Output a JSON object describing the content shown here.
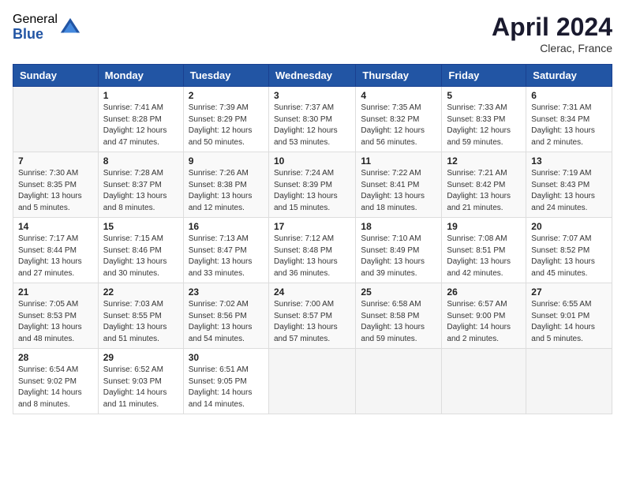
{
  "header": {
    "logo_general": "General",
    "logo_blue": "Blue",
    "title": "April 2024",
    "location": "Clerac, France"
  },
  "days_of_week": [
    "Sunday",
    "Monday",
    "Tuesday",
    "Wednesday",
    "Thursday",
    "Friday",
    "Saturday"
  ],
  "weeks": [
    [
      {
        "day": "",
        "info": ""
      },
      {
        "day": "1",
        "info": "Sunrise: 7:41 AM\nSunset: 8:28 PM\nDaylight: 12 hours\nand 47 minutes."
      },
      {
        "day": "2",
        "info": "Sunrise: 7:39 AM\nSunset: 8:29 PM\nDaylight: 12 hours\nand 50 minutes."
      },
      {
        "day": "3",
        "info": "Sunrise: 7:37 AM\nSunset: 8:30 PM\nDaylight: 12 hours\nand 53 minutes."
      },
      {
        "day": "4",
        "info": "Sunrise: 7:35 AM\nSunset: 8:32 PM\nDaylight: 12 hours\nand 56 minutes."
      },
      {
        "day": "5",
        "info": "Sunrise: 7:33 AM\nSunset: 8:33 PM\nDaylight: 12 hours\nand 59 minutes."
      },
      {
        "day": "6",
        "info": "Sunrise: 7:31 AM\nSunset: 8:34 PM\nDaylight: 13 hours\nand 2 minutes."
      }
    ],
    [
      {
        "day": "7",
        "info": "Sunrise: 7:30 AM\nSunset: 8:35 PM\nDaylight: 13 hours\nand 5 minutes."
      },
      {
        "day": "8",
        "info": "Sunrise: 7:28 AM\nSunset: 8:37 PM\nDaylight: 13 hours\nand 8 minutes."
      },
      {
        "day": "9",
        "info": "Sunrise: 7:26 AM\nSunset: 8:38 PM\nDaylight: 13 hours\nand 12 minutes."
      },
      {
        "day": "10",
        "info": "Sunrise: 7:24 AM\nSunset: 8:39 PM\nDaylight: 13 hours\nand 15 minutes."
      },
      {
        "day": "11",
        "info": "Sunrise: 7:22 AM\nSunset: 8:41 PM\nDaylight: 13 hours\nand 18 minutes."
      },
      {
        "day": "12",
        "info": "Sunrise: 7:21 AM\nSunset: 8:42 PM\nDaylight: 13 hours\nand 21 minutes."
      },
      {
        "day": "13",
        "info": "Sunrise: 7:19 AM\nSunset: 8:43 PM\nDaylight: 13 hours\nand 24 minutes."
      }
    ],
    [
      {
        "day": "14",
        "info": "Sunrise: 7:17 AM\nSunset: 8:44 PM\nDaylight: 13 hours\nand 27 minutes."
      },
      {
        "day": "15",
        "info": "Sunrise: 7:15 AM\nSunset: 8:46 PM\nDaylight: 13 hours\nand 30 minutes."
      },
      {
        "day": "16",
        "info": "Sunrise: 7:13 AM\nSunset: 8:47 PM\nDaylight: 13 hours\nand 33 minutes."
      },
      {
        "day": "17",
        "info": "Sunrise: 7:12 AM\nSunset: 8:48 PM\nDaylight: 13 hours\nand 36 minutes."
      },
      {
        "day": "18",
        "info": "Sunrise: 7:10 AM\nSunset: 8:49 PM\nDaylight: 13 hours\nand 39 minutes."
      },
      {
        "day": "19",
        "info": "Sunrise: 7:08 AM\nSunset: 8:51 PM\nDaylight: 13 hours\nand 42 minutes."
      },
      {
        "day": "20",
        "info": "Sunrise: 7:07 AM\nSunset: 8:52 PM\nDaylight: 13 hours\nand 45 minutes."
      }
    ],
    [
      {
        "day": "21",
        "info": "Sunrise: 7:05 AM\nSunset: 8:53 PM\nDaylight: 13 hours\nand 48 minutes."
      },
      {
        "day": "22",
        "info": "Sunrise: 7:03 AM\nSunset: 8:55 PM\nDaylight: 13 hours\nand 51 minutes."
      },
      {
        "day": "23",
        "info": "Sunrise: 7:02 AM\nSunset: 8:56 PM\nDaylight: 13 hours\nand 54 minutes."
      },
      {
        "day": "24",
        "info": "Sunrise: 7:00 AM\nSunset: 8:57 PM\nDaylight: 13 hours\nand 57 minutes."
      },
      {
        "day": "25",
        "info": "Sunrise: 6:58 AM\nSunset: 8:58 PM\nDaylight: 13 hours\nand 59 minutes."
      },
      {
        "day": "26",
        "info": "Sunrise: 6:57 AM\nSunset: 9:00 PM\nDaylight: 14 hours\nand 2 minutes."
      },
      {
        "day": "27",
        "info": "Sunrise: 6:55 AM\nSunset: 9:01 PM\nDaylight: 14 hours\nand 5 minutes."
      }
    ],
    [
      {
        "day": "28",
        "info": "Sunrise: 6:54 AM\nSunset: 9:02 PM\nDaylight: 14 hours\nand 8 minutes."
      },
      {
        "day": "29",
        "info": "Sunrise: 6:52 AM\nSunset: 9:03 PM\nDaylight: 14 hours\nand 11 minutes."
      },
      {
        "day": "30",
        "info": "Sunrise: 6:51 AM\nSunset: 9:05 PM\nDaylight: 14 hours\nand 14 minutes."
      },
      {
        "day": "",
        "info": ""
      },
      {
        "day": "",
        "info": ""
      },
      {
        "day": "",
        "info": ""
      },
      {
        "day": "",
        "info": ""
      }
    ]
  ]
}
